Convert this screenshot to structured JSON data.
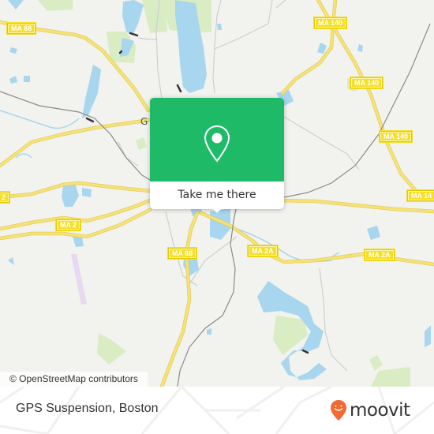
{
  "map": {
    "attribution": "© OpenStreetMap contributors",
    "place_label_partial": "G",
    "colors": {
      "land": "#f2f2ee",
      "water": "#a8d6ef",
      "park": "#d9ecc4",
      "road_major": "#f5df62",
      "road_major_casing": "#e6cf4a",
      "road_minor": "#cfcfcf",
      "railway": "#808080",
      "airport": "#e8d8f2"
    },
    "route_shields": [
      {
        "id": "ma68-nw",
        "label": "MA 68"
      },
      {
        "id": "ma140-n",
        "label": "MA 140"
      },
      {
        "id": "ma140-mid",
        "label": "MA 140"
      },
      {
        "id": "ma140-e1",
        "label": "MA 140"
      },
      {
        "id": "ma140-e2",
        "label": "MA 14"
      },
      {
        "id": "ma2-w",
        "label": "MA 2"
      },
      {
        "id": "ma68-s",
        "label": "MA 68"
      },
      {
        "id": "ma2a-c",
        "label": "MA 2A"
      },
      {
        "id": "ma2a-e",
        "label": "MA 2A"
      },
      {
        "id": "ma2-edge",
        "label": "2"
      }
    ]
  },
  "popup": {
    "icon": "location-pin-icon",
    "cta_label": "Take me there",
    "accent_color": "#1fba68"
  },
  "footer": {
    "place_name": "GPS Suspension, Boston",
    "brand": "moovit",
    "brand_color": "#f26a32"
  }
}
